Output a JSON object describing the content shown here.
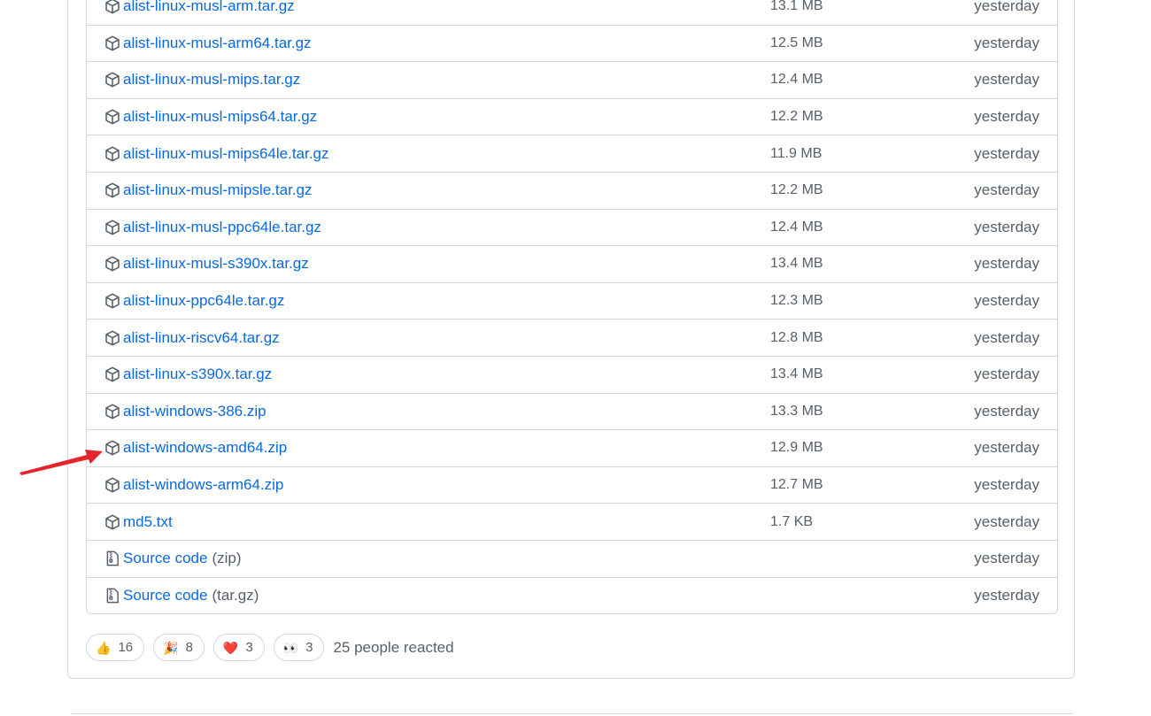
{
  "assets": [
    {
      "icon": "package-icon",
      "name": "alist-linux-musl-arm.tar.gz",
      "size": "13.1 MB",
      "date": "yesterday"
    },
    {
      "icon": "package-icon",
      "name": "alist-linux-musl-arm64.tar.gz",
      "size": "12.5 MB",
      "date": "yesterday"
    },
    {
      "icon": "package-icon",
      "name": "alist-linux-musl-mips.tar.gz",
      "size": "12.4 MB",
      "date": "yesterday"
    },
    {
      "icon": "package-icon",
      "name": "alist-linux-musl-mips64.tar.gz",
      "size": "12.2 MB",
      "date": "yesterday"
    },
    {
      "icon": "package-icon",
      "name": "alist-linux-musl-mips64le.tar.gz",
      "size": "11.9 MB",
      "date": "yesterday"
    },
    {
      "icon": "package-icon",
      "name": "alist-linux-musl-mipsle.tar.gz",
      "size": "12.2 MB",
      "date": "yesterday"
    },
    {
      "icon": "package-icon",
      "name": "alist-linux-musl-ppc64le.tar.gz",
      "size": "12.4 MB",
      "date": "yesterday"
    },
    {
      "icon": "package-icon",
      "name": "alist-linux-musl-s390x.tar.gz",
      "size": "13.4 MB",
      "date": "yesterday"
    },
    {
      "icon": "package-icon",
      "name": "alist-linux-ppc64le.tar.gz",
      "size": "12.3 MB",
      "date": "yesterday"
    },
    {
      "icon": "package-icon",
      "name": "alist-linux-riscv64.tar.gz",
      "size": "12.8 MB",
      "date": "yesterday"
    },
    {
      "icon": "package-icon",
      "name": "alist-linux-s390x.tar.gz",
      "size": "13.4 MB",
      "date": "yesterday"
    },
    {
      "icon": "package-icon",
      "name": "alist-windows-386.zip",
      "size": "13.3 MB",
      "date": "yesterday"
    },
    {
      "icon": "package-icon",
      "name": "alist-windows-amd64.zip",
      "size": "12.9 MB",
      "date": "yesterday"
    },
    {
      "icon": "package-icon",
      "name": "alist-windows-arm64.zip",
      "size": "12.7 MB",
      "date": "yesterday"
    },
    {
      "icon": "package-icon",
      "name": "md5.txt",
      "size": "1.7 KB",
      "date": "yesterday"
    }
  ],
  "source_code": [
    {
      "icon": "file-zip-icon",
      "label": "Source code",
      "suffix": "(zip)",
      "date": "yesterday"
    },
    {
      "icon": "file-zip-icon",
      "label": "Source code",
      "suffix": "(tar.gz)",
      "date": "yesterday"
    }
  ],
  "reactions": [
    {
      "emoji": "👍",
      "icon": "thumbs-up-icon",
      "count": "16"
    },
    {
      "emoji": "🎉",
      "icon": "party-popper-icon",
      "count": "8"
    },
    {
      "emoji": "❤️",
      "icon": "heart-icon",
      "count": "3"
    },
    {
      "emoji": "👀",
      "icon": "eyes-icon",
      "count": "3"
    }
  ],
  "reaction_summary": "25 people reacted",
  "colors": {
    "link": "#0969da",
    "muted": "#57606a",
    "border": "#d0d7de",
    "annotation_arrow": "#e5252a"
  }
}
